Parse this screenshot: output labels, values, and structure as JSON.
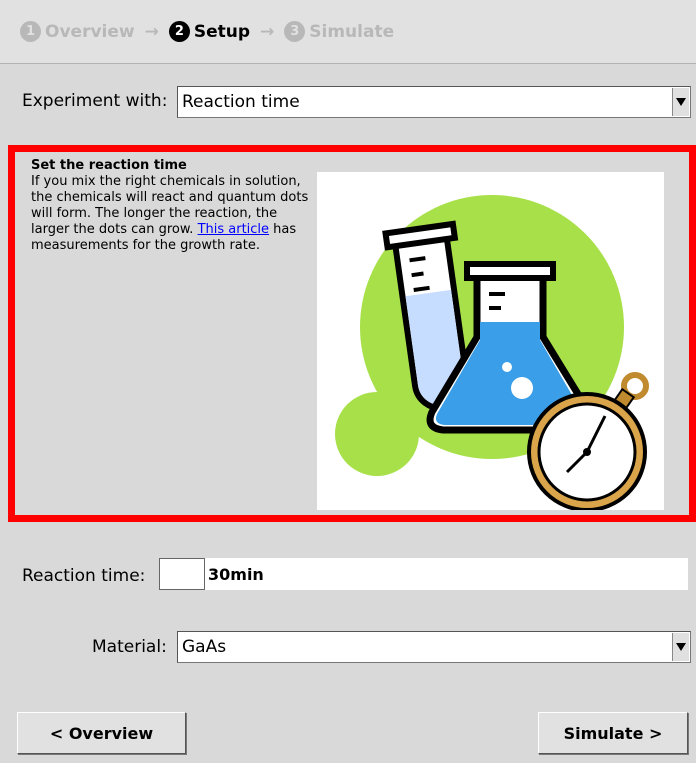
{
  "wizard": {
    "steps": [
      {
        "num": "1",
        "label": "Overview"
      },
      {
        "num": "2",
        "label": "Setup"
      },
      {
        "num": "3",
        "label": "Simulate"
      }
    ],
    "arrow": "→"
  },
  "experiment": {
    "label": "Experiment with:",
    "selected": "Reaction time"
  },
  "description": {
    "title": "Set the reaction time",
    "body_before": "If you mix the right chemicals in solution, the chemicals will react and quantum dots will form. The longer the reaction, the larger the dots can grow. ",
    "link_text": "This article",
    "body_after": " has measurements for the growth rate."
  },
  "reaction_time": {
    "label": "Reaction time:",
    "value": "30min"
  },
  "material": {
    "label": "Material:",
    "selected": "GaAs"
  },
  "buttons": {
    "back_label": "< Overview",
    "next_label": "Simulate >"
  },
  "colors": {
    "highlight_border": "#ff0000",
    "link": "#0000ff",
    "blob_green": "#a8e04a",
    "liquid_blue": "#3a9ee8"
  }
}
